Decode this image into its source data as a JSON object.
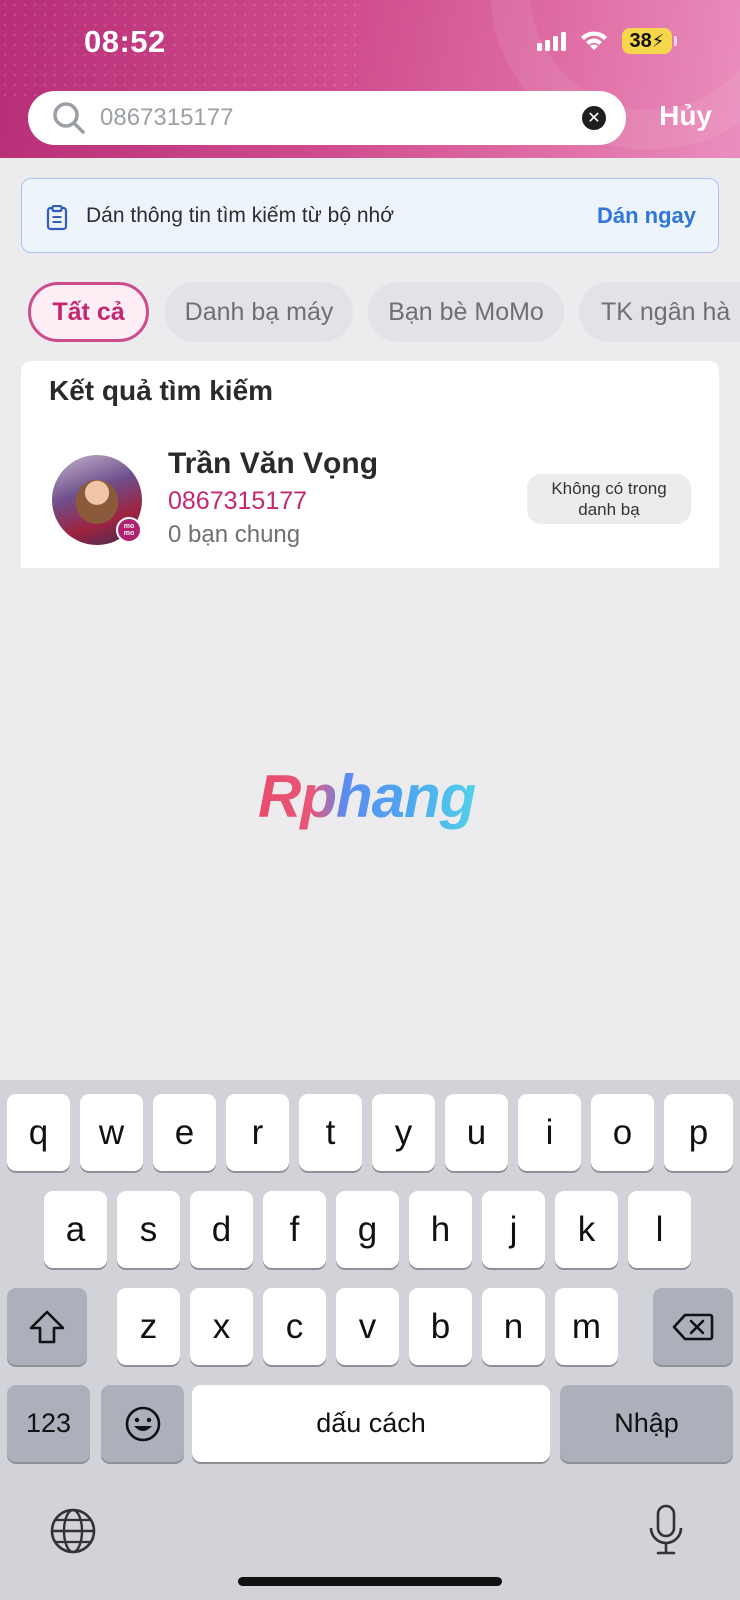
{
  "status_bar": {
    "time": "08:52",
    "battery": "38"
  },
  "search": {
    "value": "0867315177",
    "cancel_label": "Hủy"
  },
  "paste_banner": {
    "text": "Dán thông tin tìm kiếm từ bộ nhớ",
    "action": "Dán ngay"
  },
  "filters": {
    "chips": [
      {
        "label": "Tất cả",
        "active": true
      },
      {
        "label": "Danh bạ máy",
        "active": false
      },
      {
        "label": "Bạn bè MoMo",
        "active": false
      },
      {
        "label": "TK ngân hà",
        "active": false
      }
    ]
  },
  "results": {
    "title": "Kết quả tìm kiếm",
    "items": [
      {
        "name": "Trần Văn Vọng",
        "phone": "0867315177",
        "mutual": "0 bạn chung",
        "badge_line1": "Không có trong",
        "badge_line2": "danh bạ",
        "momo_badge_line1": "mo",
        "momo_badge_line2": "mo"
      }
    ]
  },
  "watermark": "Rphang",
  "keyboard": {
    "row1": [
      "q",
      "w",
      "e",
      "r",
      "t",
      "y",
      "u",
      "i",
      "o",
      "p"
    ],
    "row2": [
      "a",
      "s",
      "d",
      "f",
      "g",
      "h",
      "j",
      "k",
      "l"
    ],
    "row3": [
      "z",
      "x",
      "c",
      "v",
      "b",
      "n",
      "m"
    ],
    "numbers_label": "123",
    "space_label": "dấu cách",
    "return_label": "Nhập"
  },
  "colors": {
    "brand": "#c2286f",
    "accent_link": "#2f77d8"
  }
}
